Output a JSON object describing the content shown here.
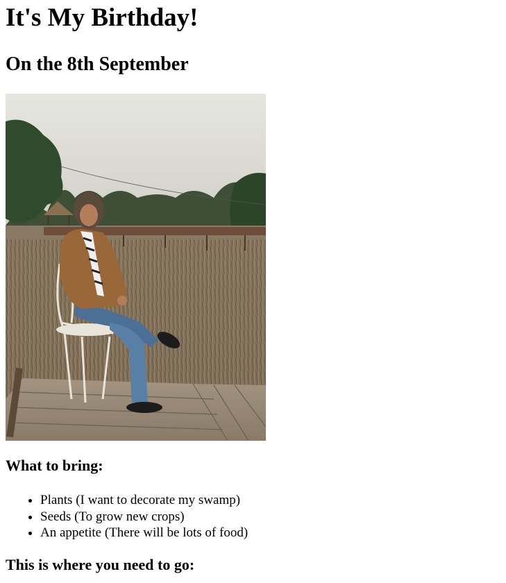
{
  "page": {
    "title": "It's My Birthday!",
    "subtitle": "On the 8th September"
  },
  "photo": {
    "icon": "photo-of-person-sitting-on-chair-on-wooden-deck"
  },
  "bring": {
    "heading": "What to bring:",
    "items": [
      "Plants (I want to decorate my swamp)",
      "Seeds (To grow new crops)",
      "An appetite (There will be lots of food)"
    ]
  },
  "directions": {
    "heading": "This is where you need to go:"
  }
}
